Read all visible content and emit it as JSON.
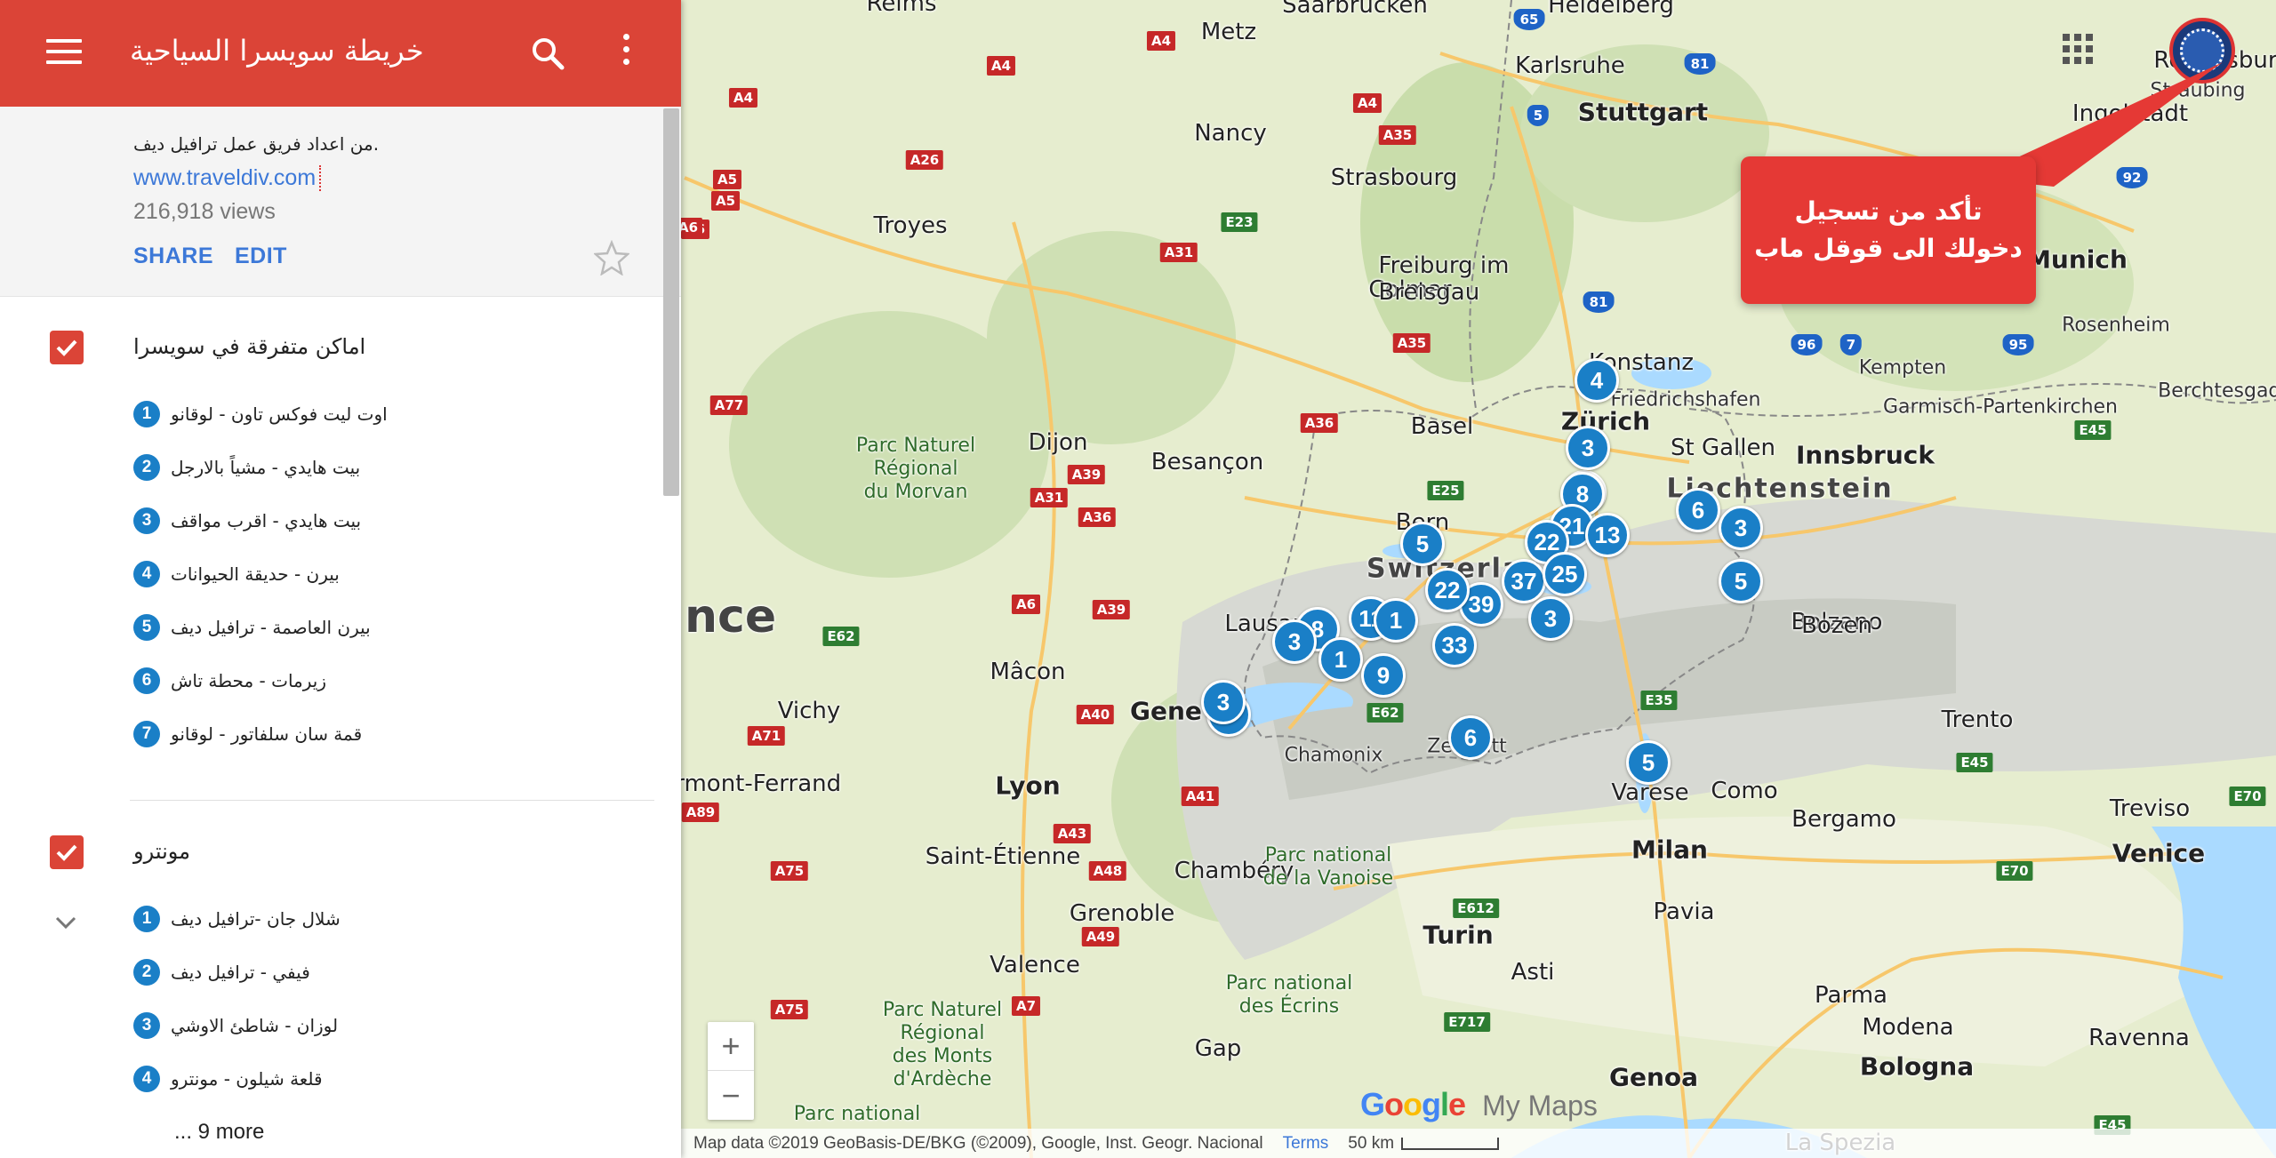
{
  "header": {
    "title": "خريطة سويسرا السياحية"
  },
  "info": {
    "credit": "من اعداد فريق عمل ترافيل ديف.",
    "link": "www.traveldiv.com",
    "views": "216,918 views",
    "share_label": "SHARE",
    "edit_label": "EDIT"
  },
  "layers": [
    {
      "title": "اماكن متفرقة في سويسرا",
      "items": [
        {
          "num": "1",
          "label": "اوت ليت فوكس تاون - لوقانو"
        },
        {
          "num": "2",
          "label": "بيت هايدي - مشياً بالارجل"
        },
        {
          "num": "3",
          "label": "بيت هايدي - اقرب مواقف"
        },
        {
          "num": "4",
          "label": "بيرن - حديقة الحيوانات"
        },
        {
          "num": "5",
          "label": "بيرن العاصمة - ترافيل ديف"
        },
        {
          "num": "6",
          "label": "زيرمات - محطة تاش"
        },
        {
          "num": "7",
          "label": "قمة سان سلفاتور - لوقانو"
        }
      ]
    },
    {
      "title": "مونترو",
      "items": [
        {
          "num": "1",
          "label": "شلال جان -ترافيل ديف"
        },
        {
          "num": "2",
          "label": "فيفي - ترافيل ديف"
        },
        {
          "num": "3",
          "label": "لوزان - شاطئ الاوشي"
        },
        {
          "num": "4",
          "label": "قلعة شيلون - مونترو"
        }
      ],
      "more": "... 9 more"
    }
  ],
  "callout": {
    "line1": "تأكد من تسجيل",
    "line2": "دخولك الى قوقل ماب"
  },
  "map": {
    "places": [
      {
        "t": "Reims",
        "c": "city"
      },
      {
        "t": "Metz",
        "c": "city"
      },
      {
        "t": "Saarbrücken",
        "c": "city"
      },
      {
        "t": "Heidelberg",
        "c": "city"
      },
      {
        "t": "Karlsruhe",
        "c": "city"
      },
      {
        "t": "Stuttgart",
        "c": "big"
      },
      {
        "t": "Ingolstadt",
        "c": "city"
      },
      {
        "t": "Regensburg",
        "c": "city"
      },
      {
        "t": "Straubing",
        "c": "small"
      },
      {
        "t": "Nancy",
        "c": "city"
      },
      {
        "t": "Strasbourg",
        "c": "city"
      },
      {
        "t": "Troyes",
        "c": "city"
      },
      {
        "t": "Colmar",
        "c": "city"
      },
      {
        "t": "Freiburg im\nBreisgau",
        "c": "city"
      },
      {
        "t": "Konstanz",
        "c": "city"
      },
      {
        "t": "Friedrichshafen",
        "c": "small"
      },
      {
        "t": "Kempten",
        "c": "small"
      },
      {
        "t": "Munich",
        "c": "big"
      },
      {
        "t": "Rosenheim",
        "c": "small"
      },
      {
        "t": "Garmisch-Partenkirchen",
        "c": "small"
      },
      {
        "t": "Berchtesgaden",
        "c": "small"
      },
      {
        "t": "Dijon",
        "c": "city"
      },
      {
        "t": "Besançon",
        "c": "city"
      },
      {
        "t": "Basel",
        "c": "city"
      },
      {
        "t": "Zürich",
        "c": "big"
      },
      {
        "t": "St Gallen",
        "c": "city"
      },
      {
        "t": "Liechtenstein",
        "c": "country"
      },
      {
        "t": "Innsbruck",
        "c": "big"
      },
      {
        "t": "Bern",
        "c": "city"
      },
      {
        "t": "Switzerland",
        "c": "country"
      },
      {
        "t": "Bolzano",
        "c": "city"
      },
      {
        "t": "Bozen",
        "c": "city"
      },
      {
        "t": "Lausanne",
        "c": "city"
      },
      {
        "t": "Mâcon",
        "c": "city"
      },
      {
        "t": "Geneva",
        "c": "big"
      },
      {
        "t": "Chamonix",
        "c": "small"
      },
      {
        "t": "Zermatt",
        "c": "small"
      },
      {
        "t": "Trento",
        "c": "city"
      },
      {
        "t": "Vichy",
        "c": "city"
      },
      {
        "t": "Lyon",
        "c": "big"
      },
      {
        "t": "Clermont-Ferrand",
        "c": "city"
      },
      {
        "t": "Chambéry",
        "c": "city"
      },
      {
        "t": "Saint-Étienne",
        "c": "city"
      },
      {
        "t": "Grenoble",
        "c": "city"
      },
      {
        "t": "Varese",
        "c": "city"
      },
      {
        "t": "Como",
        "c": "city"
      },
      {
        "t": "Bergamo",
        "c": "city"
      },
      {
        "t": "Milan",
        "c": "big"
      },
      {
        "t": "Treviso",
        "c": "city"
      },
      {
        "t": "Venice",
        "c": "big"
      },
      {
        "t": "Valence",
        "c": "city"
      },
      {
        "t": "Turin",
        "c": "big"
      },
      {
        "t": "Pavia",
        "c": "city"
      },
      {
        "t": "Asti",
        "c": "city"
      },
      {
        "t": "Gap",
        "c": "city"
      },
      {
        "t": "Parma",
        "c": "city"
      },
      {
        "t": "Modena",
        "c": "city"
      },
      {
        "t": "Bologna",
        "c": "big"
      },
      {
        "t": "Ravenna",
        "c": "city"
      },
      {
        "t": "Genoa",
        "c": "big"
      },
      {
        "t": "La Spezia",
        "c": "city"
      },
      {
        "t": "Parc Naturel\nRégional\ndu Morvan",
        "c": "park"
      },
      {
        "t": "Parc national\nde la Vanoise",
        "c": "park"
      },
      {
        "t": "Parc national\ndes Écrins",
        "c": "park"
      },
      {
        "t": "Parc Naturel\nRégional\ndes Monts\nd'Ardèche",
        "c": "park"
      },
      {
        "t": "Parc national",
        "c": "park"
      }
    ],
    "roads": [
      {
        "t": "A4"
      },
      {
        "t": "A4"
      },
      {
        "t": "A4"
      },
      {
        "t": "A4"
      },
      {
        "t": "A26"
      },
      {
        "t": "A31"
      },
      {
        "t": "A5"
      },
      {
        "t": "A6"
      },
      {
        "t": "E23",
        "g": true
      },
      {
        "t": "A35"
      },
      {
        "t": "A35"
      },
      {
        "t": "A36"
      },
      {
        "t": "A39"
      },
      {
        "t": "A31"
      },
      {
        "t": "A36"
      },
      {
        "t": "A6"
      },
      {
        "t": "A39"
      },
      {
        "t": "A77"
      },
      {
        "t": "A6"
      },
      {
        "t": "E62",
        "g": true
      },
      {
        "t": "A40"
      },
      {
        "t": "A71"
      },
      {
        "t": "A89"
      },
      {
        "t": "A41"
      },
      {
        "t": "A43"
      },
      {
        "t": "A48"
      },
      {
        "t": "A75"
      },
      {
        "t": "A49"
      },
      {
        "t": "A7"
      },
      {
        "t": "A75"
      },
      {
        "t": "E25",
        "g": true
      },
      {
        "t": "E62",
        "g": true
      },
      {
        "t": "E35",
        "g": true
      },
      {
        "t": "E45",
        "g": true
      },
      {
        "t": "E45",
        "g": true
      },
      {
        "t": "E70",
        "g": true
      },
      {
        "t": "E70",
        "g": true
      },
      {
        "t": "E612",
        "g": true
      },
      {
        "t": "E717",
        "g": true
      },
      {
        "t": "E45",
        "g": true
      },
      {
        "t": "65",
        "b": true
      },
      {
        "t": "5",
        "b": true
      },
      {
        "t": "81",
        "b": true
      },
      {
        "t": "81",
        "b": true
      },
      {
        "t": "96",
        "b": true
      },
      {
        "t": "7",
        "b": true
      },
      {
        "t": "95",
        "b": true
      },
      {
        "t": "92",
        "b": true
      },
      {
        "t": "A5"
      },
      {
        "t": "A6"
      }
    ],
    "pins": [
      "4",
      "8",
      "3",
      "8",
      "21",
      "22",
      "13",
      "6",
      "3",
      "5",
      "5",
      "37",
      "25",
      "39",
      "11",
      "1",
      "8",
      "3",
      "1",
      "9",
      "33",
      "3",
      "22",
      "8",
      "6",
      "5",
      "3"
    ]
  },
  "controls": {
    "zoom_in": "+",
    "zoom_out": "−",
    "brand_google": "Google",
    "brand_mymaps": "My Maps"
  },
  "footer": {
    "attribution": "Map data ©2019 GeoBasis-DE/BKG (©2009), Google, Inst. Geogr. Nacional",
    "terms": "Terms",
    "scale": "50 km"
  },
  "colors": {
    "header": "#db4437",
    "link": "#3c78d8",
    "pin": "#1a7fc7",
    "callout": "#e53935"
  }
}
